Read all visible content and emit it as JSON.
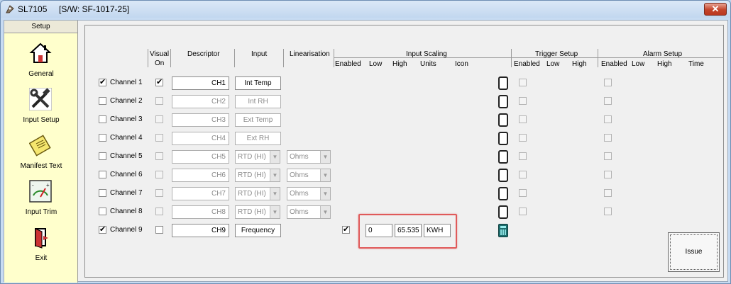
{
  "window": {
    "title": "SL7105     [S/W: SF-1017-25]",
    "close_label": "✕"
  },
  "sidebar": {
    "header": "Setup",
    "items": [
      {
        "label": "General",
        "icon": "house-icon"
      },
      {
        "label": "Input Setup",
        "icon": "tools-icon"
      },
      {
        "label": "Manifest Text",
        "icon": "notepad-icon"
      },
      {
        "label": "Input Trim",
        "icon": "gauge-icon"
      },
      {
        "label": "Exit",
        "icon": "exit-door-icon"
      }
    ]
  },
  "headers": {
    "visual": "Visual",
    "on": "On",
    "descriptor": "Descriptor",
    "input": "Input",
    "linearisation": "Linearisation",
    "input_scaling": "Input Scaling",
    "scaling_cols": [
      "Enabled",
      "Low",
      "High",
      "Units",
      "Icon"
    ],
    "trigger_setup": "Trigger Setup",
    "trigger_cols": [
      "Enabled",
      "Low",
      "High"
    ],
    "alarm_setup": "Alarm Setup",
    "alarm_cols": [
      "Enabled",
      "Low",
      "High",
      "Time"
    ]
  },
  "channels": [
    {
      "label": "Channel 1",
      "enabled": true,
      "visual_on": true,
      "descriptor": "CH1",
      "input": "Int Temp",
      "linearisation": ""
    },
    {
      "label": "Channel 2",
      "enabled": false,
      "visual_on": false,
      "descriptor": "CH2",
      "input": "Int RH",
      "linearisation": ""
    },
    {
      "label": "Channel 3",
      "enabled": false,
      "visual_on": false,
      "descriptor": "CH3",
      "input": "Ext Temp",
      "linearisation": ""
    },
    {
      "label": "Channel 4",
      "enabled": false,
      "visual_on": false,
      "descriptor": "CH4",
      "input": "Ext RH",
      "linearisation": ""
    },
    {
      "label": "Channel 5",
      "enabled": false,
      "visual_on": false,
      "descriptor": "CH5",
      "input": "RTD (HI)",
      "linearisation": "Ohms"
    },
    {
      "label": "Channel 6",
      "enabled": false,
      "visual_on": false,
      "descriptor": "CH6",
      "input": "RTD (HI)",
      "linearisation": "Ohms"
    },
    {
      "label": "Channel 7",
      "enabled": false,
      "visual_on": false,
      "descriptor": "CH7",
      "input": "RTD (HI)",
      "linearisation": "Ohms"
    },
    {
      "label": "Channel 8",
      "enabled": false,
      "visual_on": false,
      "descriptor": "CH8",
      "input": "RTD (HI)",
      "linearisation": "Ohms"
    },
    {
      "label": "Channel 9",
      "enabled": true,
      "visual_on": false,
      "descriptor": "CH9",
      "input": "Frequency",
      "linearisation": ""
    }
  ],
  "scaling": {
    "enabled": true,
    "low": "0",
    "high": "65.535",
    "units": "KWH"
  },
  "issue_button": "Issue",
  "check_mark": "✔",
  "dropdown_arrow": "▼"
}
